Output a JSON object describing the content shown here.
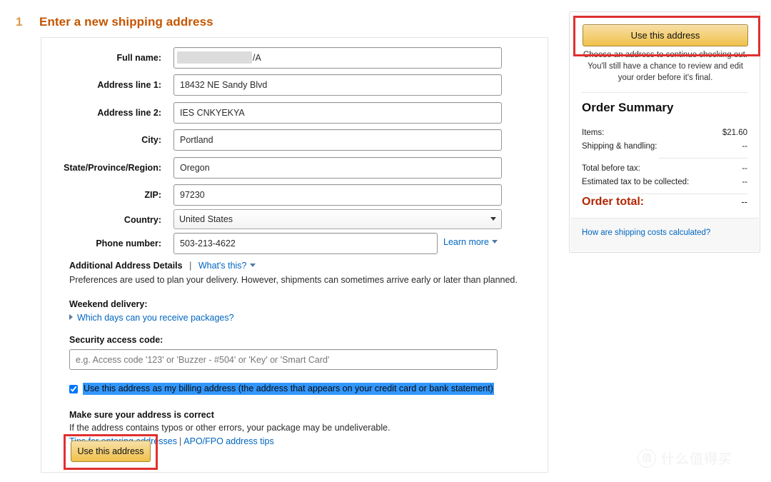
{
  "step": {
    "number": "1",
    "title": "Enter a new shipping address"
  },
  "form": {
    "fields": [
      {
        "label": "Full name:",
        "value": "/A",
        "redacted": true
      },
      {
        "label": "Address line 1:",
        "value": "18432 NE Sandy Blvd"
      },
      {
        "label": "Address line 2:",
        "value": "IES CNKYEKYA"
      },
      {
        "label": "City:",
        "value": "Portland"
      },
      {
        "label": "State/Province/Region:",
        "value": "Oregon"
      },
      {
        "label": "ZIP:",
        "value": "97230"
      },
      {
        "label": "Country:",
        "value": "United States"
      },
      {
        "label": "Phone number:",
        "value": "503-213-4622"
      }
    ],
    "learn_more_label": "Learn more"
  },
  "additional": {
    "title": "Additional Address Details",
    "separator": "|",
    "whats_this_label": "What's this?",
    "preferences_note": "Preferences are used to plan your delivery. However, shipments can sometimes arrive early or later than planned.",
    "weekend_title": "Weekend delivery:",
    "weekend_link": "Which days can you receive packages?",
    "security_title": "Security access code:",
    "security_placeholder": "e.g. Access code '123' or 'Buzzer - #504' or 'Key' or 'Smart Card'",
    "billing_checkbox_label": "Use this address as my billing address (the address that appears on your credit card or bank statement)",
    "billing_checked": true
  },
  "make_sure": {
    "title": "Make sure your address is correct",
    "note": "If the address contains typos or other errors, your package may be undeliverable.",
    "tips_link": "Tips for entering addresses",
    "tips_separator": "|",
    "apo_link": "APO/FPO address tips"
  },
  "buttons": {
    "bottom_use_address": "Use this address",
    "sidebar_use_address": "Use this address"
  },
  "sidebar": {
    "note": "Choose an address to continue checking out. You'll still have a chance to review and edit your order before it's final.",
    "summary_title": "Order Summary",
    "rows": [
      {
        "label": "Items:",
        "value": "$21.60"
      },
      {
        "label": "Shipping & handling:",
        "value": "--"
      },
      {
        "label": "Total before tax:",
        "value": "--"
      },
      {
        "label": "Estimated tax to be collected:",
        "value": "--"
      }
    ],
    "total_label": "Order total:",
    "total_value": "--",
    "shipping_costs_link": "How are shipping costs calculated?"
  },
  "watermark": {
    "logo": "值",
    "text": "什么值得买"
  },
  "colors": {
    "accent_orange": "#c45500",
    "link_blue": "#0066c0",
    "button_yellow": "#f0c14b",
    "highlight_red": "#e03030",
    "total_red": "#b12704",
    "selection_blue": "#3297fd"
  }
}
